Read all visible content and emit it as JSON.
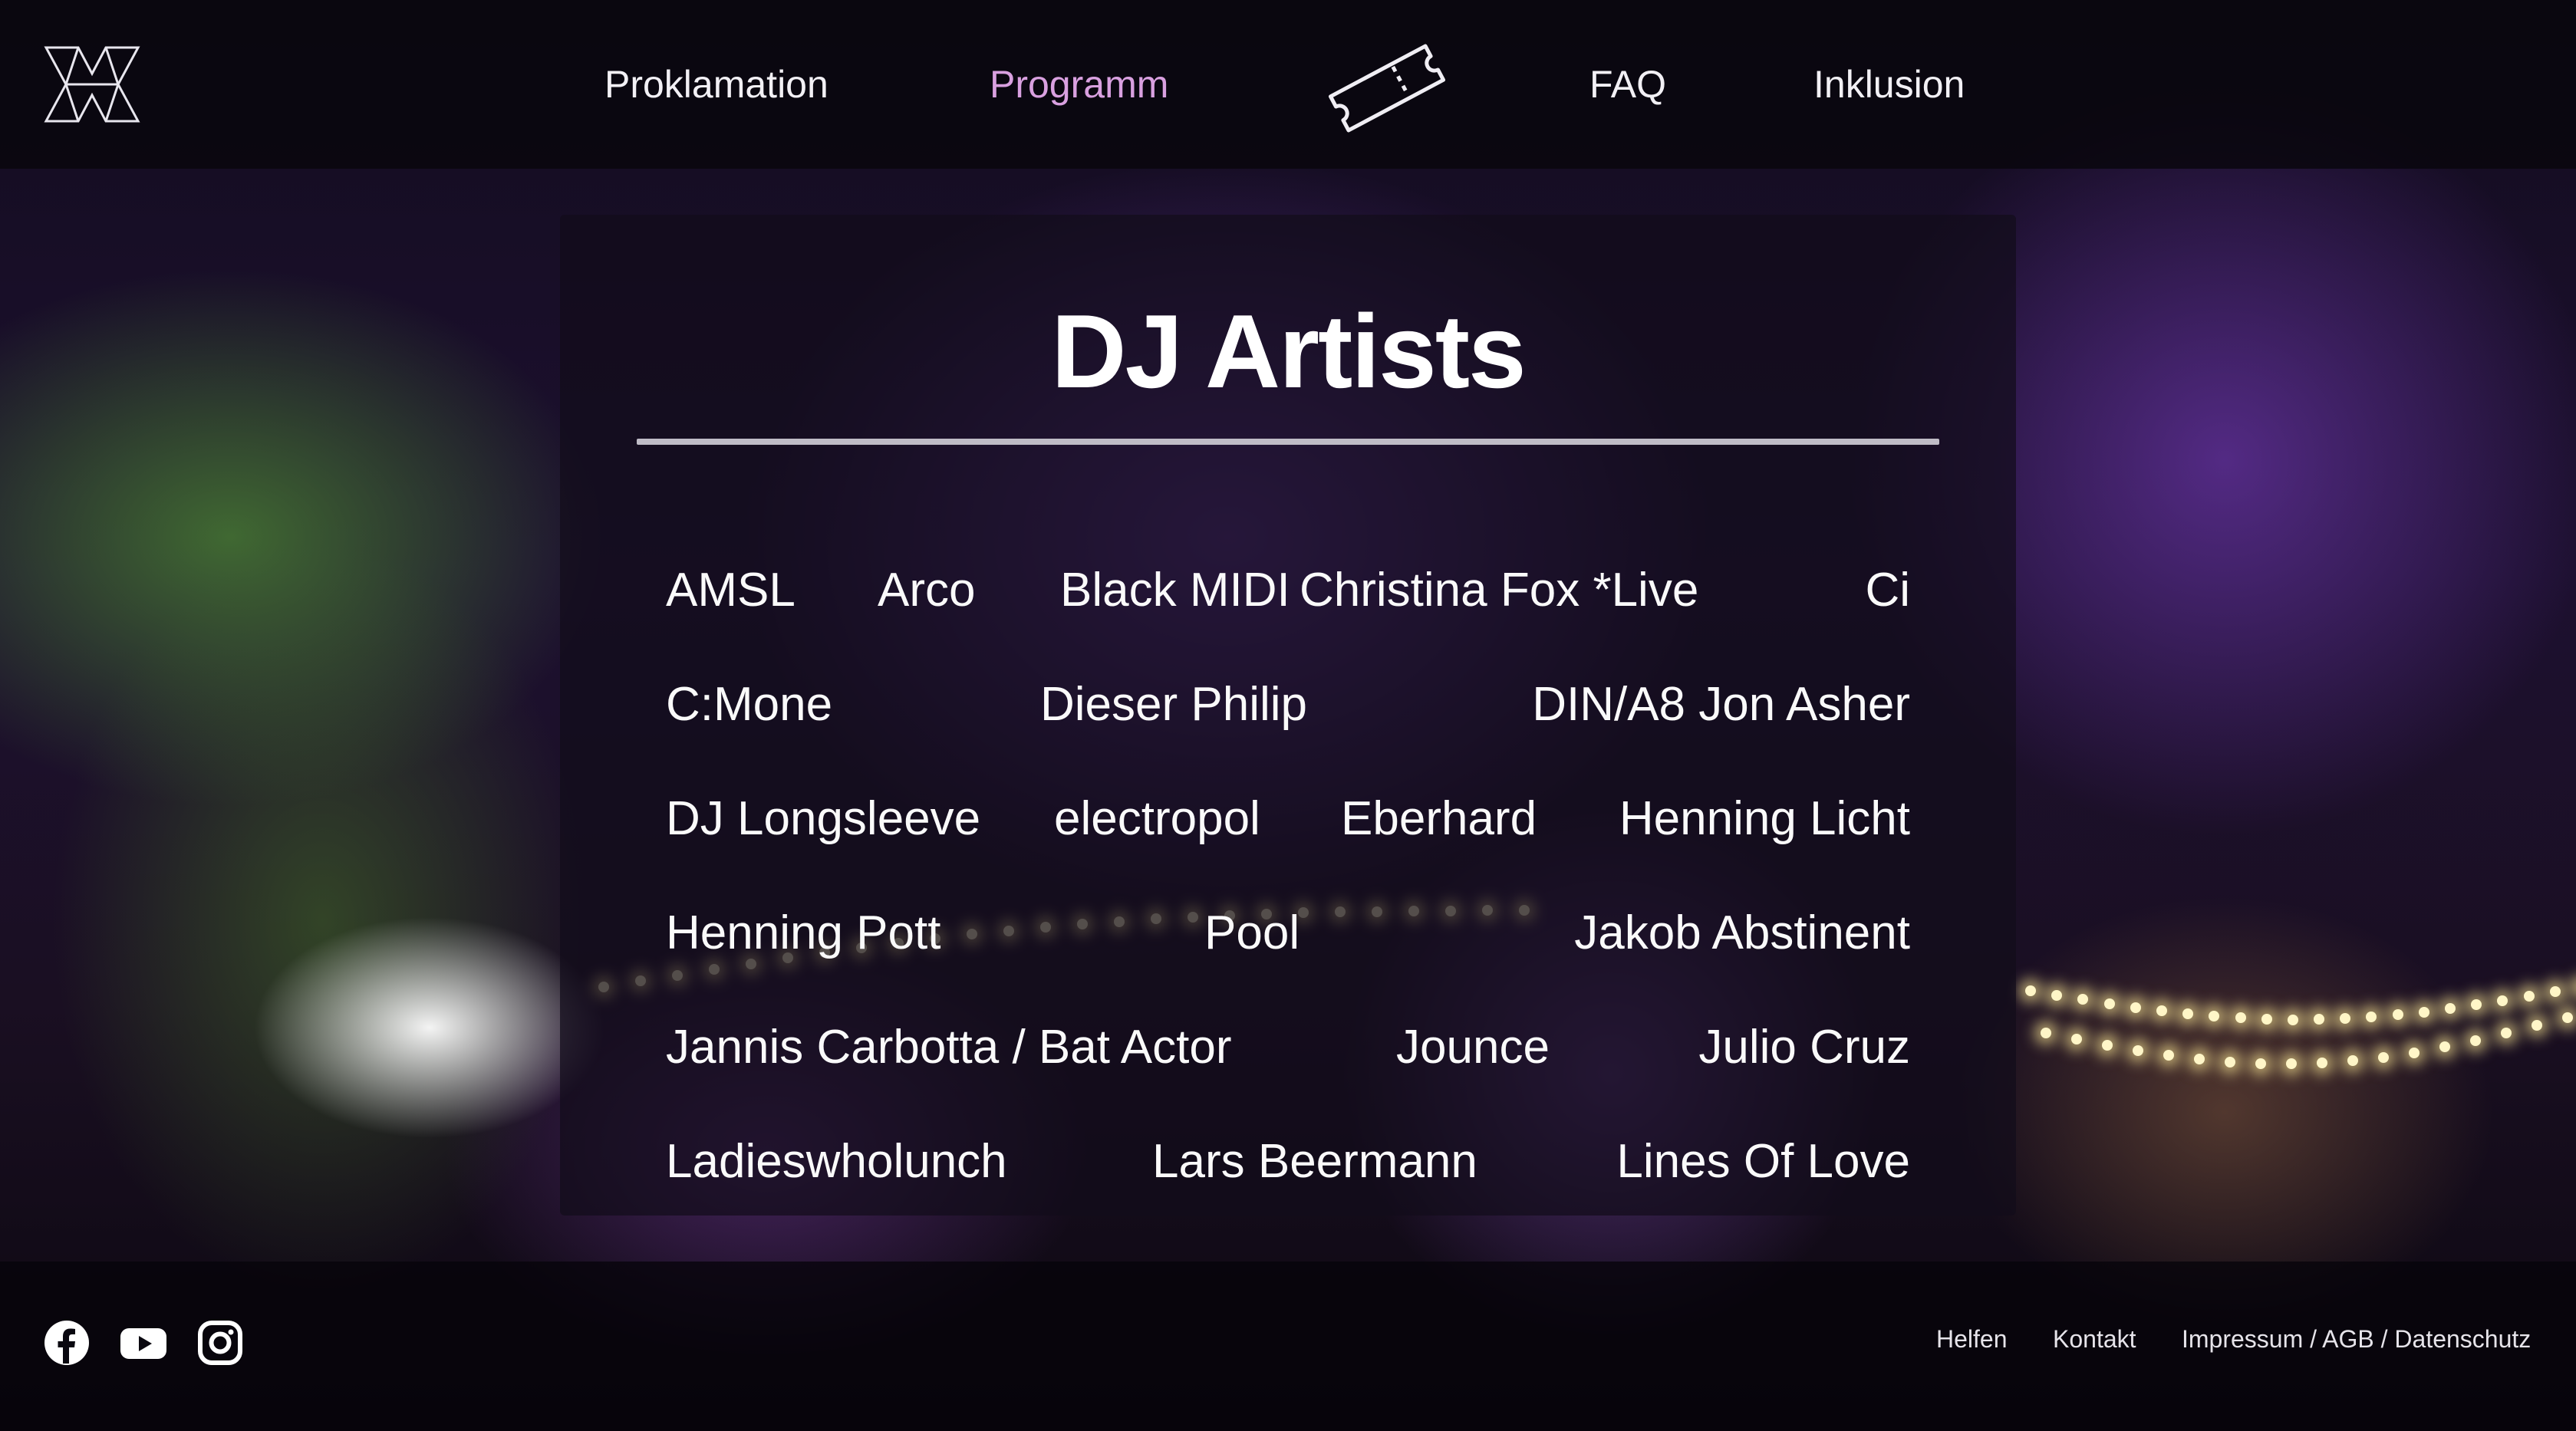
{
  "nav": {
    "items": [
      {
        "label": "Proklamation",
        "active": false
      },
      {
        "label": "Programm",
        "active": true
      },
      {
        "label": "FAQ",
        "active": false
      },
      {
        "label": "Inklusion",
        "active": false
      }
    ],
    "ticket_icon": "ticket-icon",
    "logo_icon": "x-logo-icon",
    "active_color": "#d9a0e0"
  },
  "main": {
    "title": "DJ Artists",
    "rows": [
      [
        "AMSL",
        "Arco",
        "Black MIDI",
        "Christina Fox *Live",
        "Ci"
      ],
      [
        "C:Mone",
        "Dieser Philip",
        "DIN/A8 Jon Asher"
      ],
      [
        "DJ Longsleeve",
        "electropol",
        "Eberhard",
        "Henning Licht"
      ],
      [
        "Henning Pott",
        "Pool",
        "Jakob Abstinent"
      ],
      [
        "Jannis Carbotta / Bat Actor",
        "Jounce",
        "Julio Cruz"
      ],
      [
        "Ladieswholunch",
        "Lars Beermann",
        "Lines Of Love"
      ]
    ]
  },
  "footer": {
    "social": [
      "facebook-icon",
      "youtube-icon",
      "instagram-icon"
    ],
    "links": [
      "Helfen",
      "Kontakt",
      "Impressum / AGB / Datenschutz"
    ]
  }
}
